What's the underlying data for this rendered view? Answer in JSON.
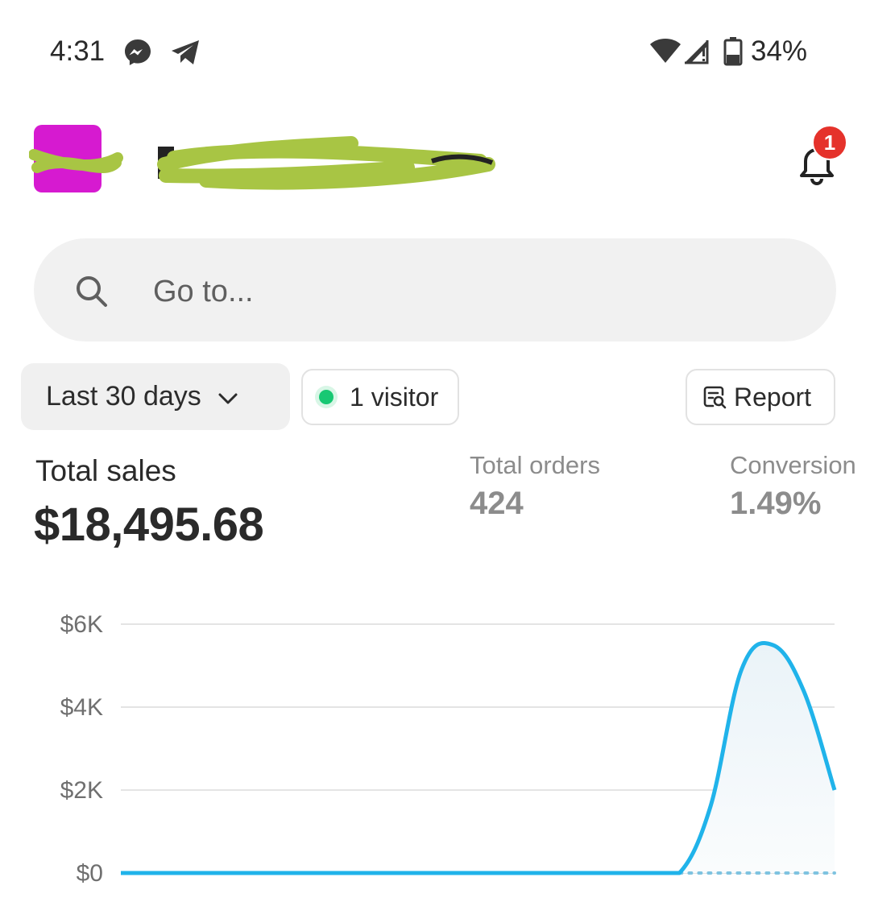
{
  "status_bar": {
    "time": "4:31",
    "battery": "34%",
    "icons": [
      "messenger-icon",
      "telegram-icon",
      "wifi-icon",
      "signal-icon",
      "battery-icon"
    ]
  },
  "header": {
    "notification_count": "1"
  },
  "search": {
    "placeholder": "Go to..."
  },
  "filters": {
    "date_range": "Last 30 days",
    "visitors": "1 visitor",
    "report": "Report"
  },
  "metrics": {
    "total_sales_label": "Total sales",
    "total_sales_value": "$18,495.68",
    "total_orders_label": "Total orders",
    "total_orders_value": "424",
    "conversion_label": "Conversion",
    "conversion_value": "1.49%"
  },
  "colors": {
    "accent_line": "#20b3ea",
    "logo": "#d61ad0",
    "badge": "#e5322b",
    "visitor_dot": "#18c873"
  },
  "chart_data": {
    "type": "area",
    "y_ticks": [
      "$6K",
      "$4K",
      "$2K",
      "$0"
    ],
    "ylim": [
      0,
      6000
    ],
    "grid": true,
    "series": [
      {
        "values": [
          0,
          0,
          0,
          0,
          0,
          0,
          0,
          0,
          0,
          0,
          0,
          0,
          0,
          0,
          0,
          0,
          0,
          0,
          0,
          1600,
          4900,
          5500,
          4400,
          2000
        ]
      }
    ]
  }
}
